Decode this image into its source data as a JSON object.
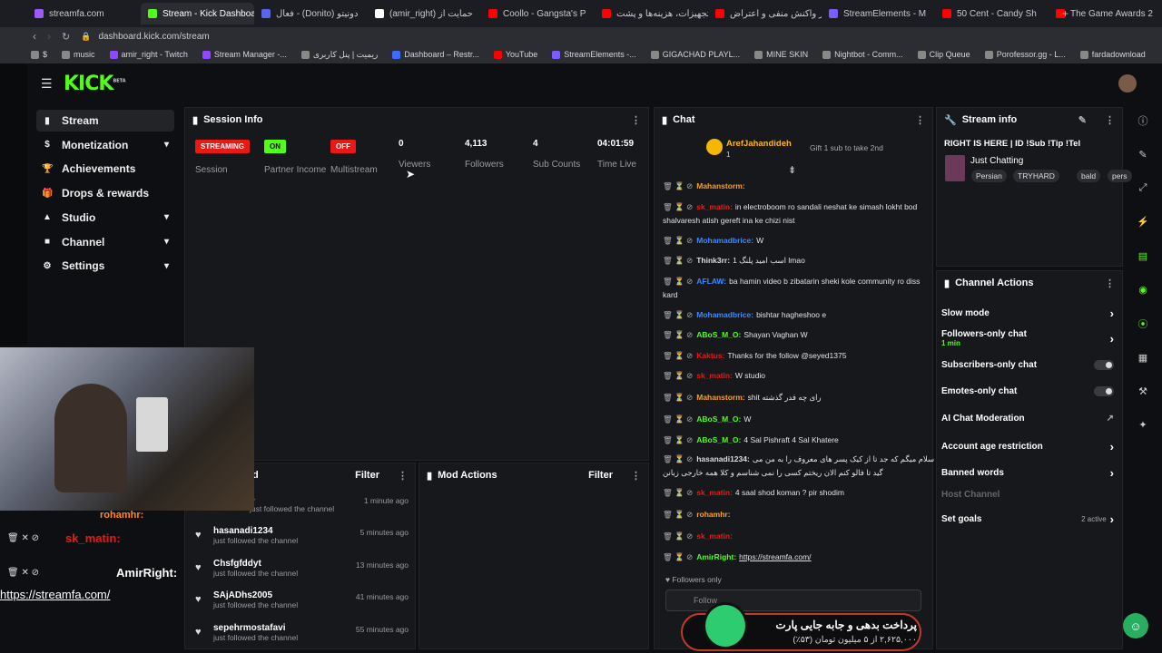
{
  "browser": {
    "tabs": [
      {
        "label": "streamfa.com",
        "color": "#9b59ff"
      },
      {
        "label": "Stream - Kick Dashboard",
        "color": "#53fc18",
        "active": true
      },
      {
        "label": "فعال - (Donito) دونیتو",
        "color": "#5865f2"
      },
      {
        "label": "(amir_right) حمایت از",
        "color": "#fff"
      },
      {
        "label": "Coollo - Gangsta's P",
        "color": "#ff0000"
      },
      {
        "label": "تجهیزات، هزینه‌ها و پشت",
        "color": "#ff0000"
      },
      {
        "label": "از واکنش منفی و اعتراض",
        "color": "#ff0000"
      },
      {
        "label": "StreamElements - M",
        "color": "#7c5cff"
      },
      {
        "label": "50 Cent - Candy Sh",
        "color": "#ff0000"
      },
      {
        "label": "The Game Awards 2",
        "color": "#ff0000"
      }
    ],
    "new_tab": "+",
    "url": "dashboard.kick.com/stream",
    "bookmarks": [
      {
        "label": "$",
        "color": "#888"
      },
      {
        "label": "music",
        "color": "#888"
      },
      {
        "label": "amir_right - Twitch",
        "color": "#9146ff"
      },
      {
        "label": "Stream Manager -...",
        "color": "#9146ff"
      },
      {
        "label": "ریمیت | پنل کاربری",
        "color": "#888"
      },
      {
        "label": "Dashboard – Restr...",
        "color": "#3b6cff"
      },
      {
        "label": "YouTube",
        "color": "#ff0000"
      },
      {
        "label": "StreamElements -...",
        "color": "#7c5cff"
      },
      {
        "label": "GIGACHAD PLAYL...",
        "color": "#888"
      },
      {
        "label": "MINE SKIN",
        "color": "#888"
      },
      {
        "label": "Nightbot - Comm...",
        "color": "#888"
      },
      {
        "label": "Clip Queue",
        "color": "#888"
      },
      {
        "label": "Porofessor.gg - L...",
        "color": "#888"
      },
      {
        "label": "fardadownload",
        "color": "#888"
      }
    ]
  },
  "logo": "KICK",
  "logo_sup": "BETA",
  "sidebar": [
    {
      "label": "Stream",
      "icon": "stream-icon",
      "active": true
    },
    {
      "label": "Monetization",
      "icon": "dollar-icon",
      "chev": "▾"
    },
    {
      "label": "Achievements",
      "icon": "trophy-icon"
    },
    {
      "label": "Drops & rewards",
      "icon": "gift-icon"
    },
    {
      "label": "Studio",
      "icon": "studio-icon",
      "chev": "▾"
    },
    {
      "label": "Channel",
      "icon": "channel-icon",
      "chev": "▾"
    },
    {
      "label": "Settings",
      "icon": "gear-icon",
      "chev": "▾"
    }
  ],
  "session": {
    "title": "Session Info",
    "stats": [
      {
        "value": "STREAMING",
        "label": "Session",
        "badge": "#e91916"
      },
      {
        "value": "ON",
        "label": "Partner Income",
        "badge": "#53fc18"
      },
      {
        "value": "OFF",
        "label": "Multistream",
        "badge": "#e91916"
      },
      {
        "value": "0",
        "label": "Viewers"
      },
      {
        "value": "4,113",
        "label": "Followers"
      },
      {
        "value": "4",
        "label": "Sub Counts"
      },
      {
        "value": "04:01:59",
        "label": "Time Live"
      }
    ]
  },
  "activity": {
    "title_partial": "d",
    "filter": "Filter",
    "first_partial": "5",
    "first_sub": "just followed the channel",
    "first_time": "1 minute ago",
    "items": [
      {
        "name": "hasanadi1234",
        "sub": "just followed the channel",
        "time": "5 minutes ago"
      },
      {
        "name": "Chsfgfddyt",
        "sub": "just followed the channel",
        "time": "13 minutes ago"
      },
      {
        "name": "SAjADhs2005",
        "sub": "just followed the channel",
        "time": "41 minutes ago"
      },
      {
        "name": "sepehrmostafavi",
        "sub": "just followed the channel",
        "time": "55 minutes ago"
      }
    ]
  },
  "mod_actions": {
    "title": "Mod Actions",
    "filter": "Filter"
  },
  "chat": {
    "title": "Chat",
    "pinned_user": "ArefJahandideh",
    "pinned_count": "1",
    "pinned_text": "Gift 1 sub to take 2nd",
    "messages": [
      {
        "user": "Mahanstorm:",
        "color": "#ff9f1a",
        "text": ""
      },
      {
        "user": "sk_matin:",
        "color": "#e91916",
        "text": "in electroboom ro sandali neshat ke simash lokht bod shalvaresh atish gereft ina ke chizi nist"
      },
      {
        "user": "Mohamadbrice:",
        "color": "#3b8bff",
        "text": "W"
      },
      {
        "user": "Think3rr:",
        "color": "#ddd",
        "text": "اسب امید پلنگ 1 lmao"
      },
      {
        "user": "AFLAW:",
        "color": "#3b8bff",
        "text": "ba hamin video b zibatarin sheki kole community ro diss kard"
      },
      {
        "user": "Mohamadbrice:",
        "color": "#3b8bff",
        "text": "bishtar hagheshoo e"
      },
      {
        "user": "ABoS_M_O:",
        "color": "#53fc18",
        "text": "Shayan Vaghan W"
      },
      {
        "user": "Kaktus:",
        "color": "#e91916",
        "text": "Thanks for the follow @seyed1375"
      },
      {
        "user": "sk_matin:",
        "color": "#e91916",
        "text": "W studio"
      },
      {
        "user": "Mahanstorm:",
        "color": "#ff9f1a",
        "text": "shit رای چه فدر گذشته"
      },
      {
        "user": "ABoS_M_O:",
        "color": "#53fc18",
        "text": "W"
      },
      {
        "user": "ABoS_M_O:",
        "color": "#53fc18",
        "text": "4 Sal Pishraft 4 Sal Khatere"
      },
      {
        "user": "hasanadi1234:",
        "color": "#ddd",
        "text": "سلام میگم که جد تا از کیک پسر های معروف را به من می گید تا فالو کنم الان ریختم کسی را نمی شناسم و کلا همه خارجی زبانن"
      },
      {
        "user": "sk_matin:",
        "color": "#e91916",
        "text": "4 saal shod koman ? pir shodim"
      },
      {
        "user": "rohamhr:",
        "color": "#ff9f1a",
        "text": ""
      },
      {
        "user": "sk_matin:",
        "color": "#e91916",
        "text": ""
      },
      {
        "user": "AmirRight:",
        "color": "#53fc18",
        "text": "https://streamfa.com/"
      }
    ],
    "followers_only": "Followers only",
    "input_placeholder": "Follow"
  },
  "stream_info": {
    "title": "Stream info",
    "stream_title": "RIGHT IS HERE | ID !Sub !Tip !Tel",
    "category": "Just Chatting",
    "tags": [
      "Persian",
      "TRYHARD",
      "bald",
      "pers"
    ]
  },
  "channel_actions": {
    "title": "Channel Actions",
    "items": [
      {
        "label": "Slow mode",
        "type": "arrow"
      },
      {
        "label": "Followers-only chat",
        "sub": "1 min",
        "type": "arrow"
      },
      {
        "label": "Subscribers-only chat",
        "type": "toggle"
      },
      {
        "label": "Emotes-only chat",
        "type": "toggle"
      },
      {
        "label": "AI Chat Moderation",
        "type": "ext"
      },
      {
        "label": "Account age restriction",
        "type": "arrow"
      },
      {
        "label": "Banned words",
        "type": "arrow"
      },
      {
        "label": "Host Channel",
        "type": "disabled"
      },
      {
        "label": "Set goals",
        "type": "goals",
        "status": "2 active"
      }
    ]
  },
  "overlay": {
    "user": "rohamhr:",
    "line2_user": "sk_matin:",
    "line3_user": "AmirRight:",
    "link": "https://streamfa.com/",
    "donation_text": "پرداخت بدهی و جابه جایی پارت",
    "donation_amount": "۲,۶۲۵,۰۰۰ از ۵ میلیون تومان (۵۳٪)"
  }
}
